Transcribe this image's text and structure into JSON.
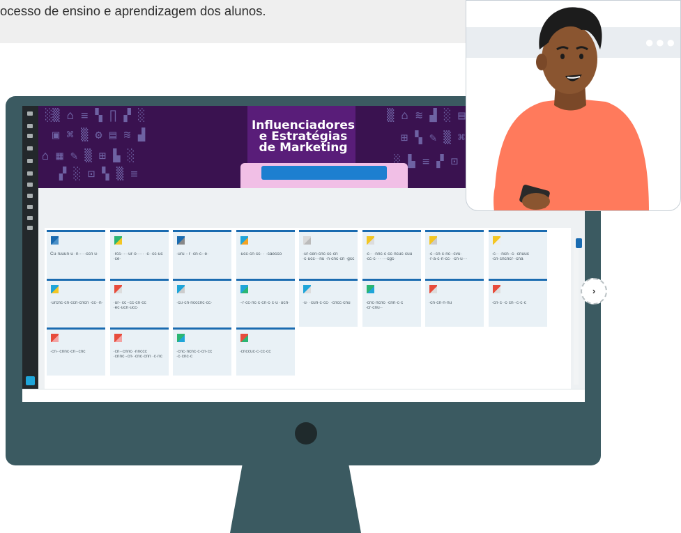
{
  "speech_bubble": {
    "text": "ocesso de ensino e aprendizagem dos alunos."
  },
  "course_banner": {
    "title_line1": "Influenciadores",
    "title_line2": "e Estratégias",
    "title_line3": "de Marketing"
  },
  "video_window": {
    "menu_dots": "●●●"
  },
  "navigation": {
    "next_label": "›"
  },
  "colors": {
    "monitor": "#3b5a61",
    "banner": "#3a1250",
    "tile_accent": "#1a6bb0",
    "shirt": "#ff7a5c",
    "skin": "#8a5530"
  },
  "tiles": [
    {
      "label": "Cu·ruuun·u ·n·····ccn u·",
      "icon": "doc"
    },
    {
      "label": "·rcs·····ur·o····· ·c··cc·uc ·ce·",
      "icon": "flag"
    },
    {
      "label": "·uru ··r ·cn·c··e·",
      "icon": "photo"
    },
    {
      "label": "·ucc·cn·cc· · ·caecco",
      "icon": "puzzle"
    },
    {
      "label": "·ur·cen·cnc·cc·cn ·c·ucc···nu ·n·cnc·cn ·gcc",
      "icon": "folder"
    },
    {
      "label": "·c·· ·nnc·c·cc·ncuc·cuu ·cc·c· ·· ···cgc·",
      "icon": "note"
    },
    {
      "label": "·c··cn·c·nc··cvu· ·r·a·c·n·cc· ·cn·u···",
      "icon": "flag-y"
    },
    {
      "label": "·c·· ·ncn··c··cnuuc ·cn·cncncr··cna",
      "icon": "box-y"
    },
    {
      "label": "·urcnc·cn·ccn·cncn ·cc··n·",
      "icon": "flag-g"
    },
    {
      "label": "·ur··cc··cc·cn·cc ·ec·ucn·ucc·",
      "icon": "flag-r"
    },
    {
      "label": "·cu·cn·ncccnc·cc·",
      "icon": "pen"
    },
    {
      "label": "··r·cc·nc·c·cn·c·c·u ·ucn·",
      "icon": "flag-c"
    },
    {
      "label": "·u· ·cun·c·cc· ·cncc·cnu",
      "icon": "list"
    },
    {
      "label": "·cnc·ncnc··cnn·c·c ·cr·cnu··",
      "icon": "grid"
    },
    {
      "label": "·cn·cn·n·nu",
      "icon": "flag-m"
    },
    {
      "label": "·cn·c··c·cn··c·c·c",
      "icon": "minus"
    },
    {
      "label": "·cn··cnnc·cn··cnc",
      "icon": "dots-r"
    },
    {
      "label": "·cn··cnnc··nnccc ·cnnc··cn··cnc·cnn ·c·nc",
      "icon": "dots-r"
    },
    {
      "label": "·cnc·ncnc·c·cn·cc ·c·cnc·c",
      "icon": "sheet"
    },
    {
      "label": "·cnccuc·c·cc·cc",
      "icon": "puzzle-c"
    }
  ]
}
